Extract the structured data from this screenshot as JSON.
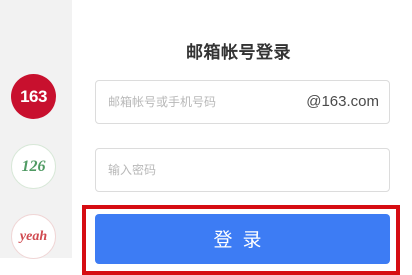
{
  "sidebar": {
    "brands": [
      {
        "label": "163",
        "color": "#c8102e"
      },
      {
        "label": "126",
        "color": "#4f9a63"
      },
      {
        "label": "yeah",
        "color": "#d0494f"
      }
    ]
  },
  "form": {
    "title": "邮箱帐号登录",
    "account": {
      "placeholder": "邮箱帐号或手机号码",
      "value": "",
      "domain": "@163.com"
    },
    "password": {
      "placeholder": "输入密码",
      "value": ""
    },
    "login_label": "登录"
  },
  "colors": {
    "accent": "#3d7cf4",
    "highlight": "#d60d12"
  }
}
